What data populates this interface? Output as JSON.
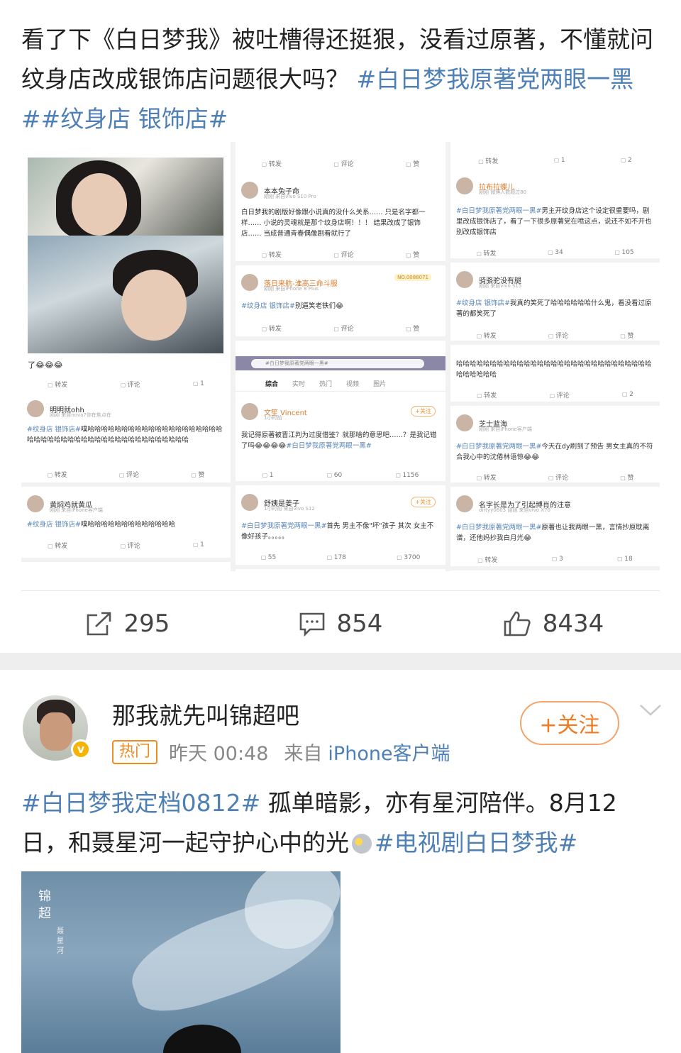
{
  "post1": {
    "text": "看了下《白日梦我》被吐槽得还挺狠，没看过原著，不懂就问纹身店改成银饰店问题很大吗？",
    "tags": "#白日梦我原著党两眼一黑##纹身店 银饰店#",
    "collage": {
      "left": {
        "caption": "了😂😂😂",
        "caption_actions": {
          "repost": "转发",
          "comment": "评论",
          "like": "1"
        },
        "cards": [
          {
            "name": "明明就ohh",
            "sub": "刚刚 来自nova7你在焦点在",
            "tag": "#纹身店 银饰店#",
            "body": "噗哈哈哈哈哈哈哈哈哈哈哈哈哈哈哈哈哈哈哈哈哈哈哈哈哈哈哈哈哈哈哈哈哈哈哈哈哈哈哈哈哈哈哈哈",
            "actions": {
              "repost": "转发",
              "comment": "评论",
              "like": "赞"
            }
          },
          {
            "name": "黄焖鸡就黄瓜",
            "sub": "刚刚 来自iPhone客户端",
            "tag": "#纹身店 银饰店#",
            "body": "噗哈哈哈哈哈哈哈哈哈哈哈哈哈",
            "actions": {
              "repost": "转发",
              "comment": "评论",
              "like": "1"
            }
          }
        ]
      },
      "middle": {
        "top_actions": {
          "repost": "转发",
          "comment": "评论",
          "like": "赞"
        },
        "cards": [
          {
            "name": "本本兔子命",
            "sub": "刚刚 来自vivo S10 Pro",
            "body": "白日梦我的剧版好像跟小说真的没什么关系…… 只是名字都一样…… 小说的灵魂就是那个纹身店啊！！！ 结果改成了银饰店…… 当成普通青春偶像剧看就行了",
            "actions": {
              "repost": "转发",
              "comment": "评论",
              "like": "赞"
            }
          },
          {
            "name": "落日来航-淮高三命斗服",
            "sub": "刚刚 来自iPhone 8 Plus",
            "badge": "NO.0088071",
            "tag": "#纹身店 银饰店#",
            "body": "别逼笑老铁们😂",
            "actions": {
              "repost": "转发",
              "comment": "评论",
              "like": "赞"
            }
          },
          {
            "name": "文笙 Vincent",
            "sub": "1小时前",
            "follow": "+关注",
            "body": "我记得原著被晋江判为过度借鉴？就那啥的意思吧……？是我记错了吗😂😂😂😂",
            "tag": "#白日梦我原著党两眼一黑#",
            "actions": {
              "repost": "1",
              "comment": "60",
              "like": "1156"
            }
          },
          {
            "name": "舒姨是姜子",
            "sub": "1小时前 来自vivo S12",
            "follow": "+关注",
            "tag": "#白日梦我原著党两眼一黑#",
            "body": "首先 男主不像\"坏\"孩子 其次 女主不像好孩子。。。。。",
            "actions": {
              "repost": "55",
              "comment": "178",
              "like": "3700"
            }
          }
        ],
        "search_placeholder": "#白日梦我原著党两眼一黑#",
        "search_tabs": [
          "综合",
          "实时",
          "热门",
          "视频",
          "图片"
        ]
      },
      "right": {
        "top_actions": {
          "repost": "转发",
          "comment": "1",
          "like": "2"
        },
        "cards": [
          {
            "name": "拉布拉蝶儿",
            "sub": "刚刚 微博人数超过80",
            "tag": "#白日梦我原著党两眼一黑#",
            "body": "男主开纹身店这个设定很重要吗，剧里改成银饰店了，看了一下很多原著党在喷这点，说还不如不开也别改成银饰店",
            "actions": {
              "repost": "转发",
              "comment": "34",
              "like": "105"
            }
          },
          {
            "name": "骑骆驼没有腿",
            "sub": "刚刚 来自vivo S15",
            "tag": "#纹身店 银饰店#",
            "body": "我真的笑死了哈哈哈哈哈哈什么鬼，看没看过原著的都笑死了",
            "actions": {
              "repost": "转发",
              "comment": "评论",
              "like": "赞"
            }
          },
          {
            "name": "",
            "sub": "",
            "body": "哈哈哈哈哈哈哈哈哈哈哈哈哈哈哈哈哈哈哈哈哈哈哈哈哈哈哈哈哈哈哈哈哈哈哈",
            "actions": {
              "repost": "转发",
              "comment": "评论",
              "like": "2"
            }
          },
          {
            "name": "芝士蓝海",
            "sub": "刚刚 来自iPhone客户端",
            "tag": "#白日梦我原著党两眼一黑#",
            "body": "今天在dy刷到了预告 男女主真的不符合我心中的沈倦林语惊😂😂",
            "actions": {
              "repost": "转发",
              "comment": "评论",
              "like": "赞"
            }
          },
          {
            "name": "名字长是为了引起博肖的注意",
            "sub": "dirtyy0603 刚刚 来自vivo X70",
            "tag": "#白日梦我原著党两眼一黑#",
            "body": "原著也让我两眼一黑，言情抄原耽离谱，还他妈抄我白月光😂",
            "actions": {
              "repost": "转发",
              "comment": "3",
              "like": "18"
            }
          }
        ]
      }
    },
    "actions": {
      "repost": "295",
      "comment": "854",
      "like": "8434"
    }
  },
  "post2": {
    "username": "那我就先叫锦超吧",
    "hot_badge": "热门",
    "time": "昨天 00:48",
    "source_prefix": "来自",
    "source": "iPhone客户端",
    "follow_label": "+关注",
    "tag1": "#白日梦我定档0812#",
    "text_a": "孤单暗影，亦有星河陪伴。8月12日，和聂星河一起守护心中的光",
    "tag2": "#电视剧白日梦我#",
    "poster_title": "锦超",
    "poster_sub": "聂星河"
  },
  "colors": {
    "link": "#4e7fb5",
    "accent": "#f07b22",
    "verified": "#f6b400"
  },
  "icons": [
    "repost-icon",
    "comment-icon",
    "like-icon",
    "chevron-down-icon",
    "verified-icon"
  ]
}
